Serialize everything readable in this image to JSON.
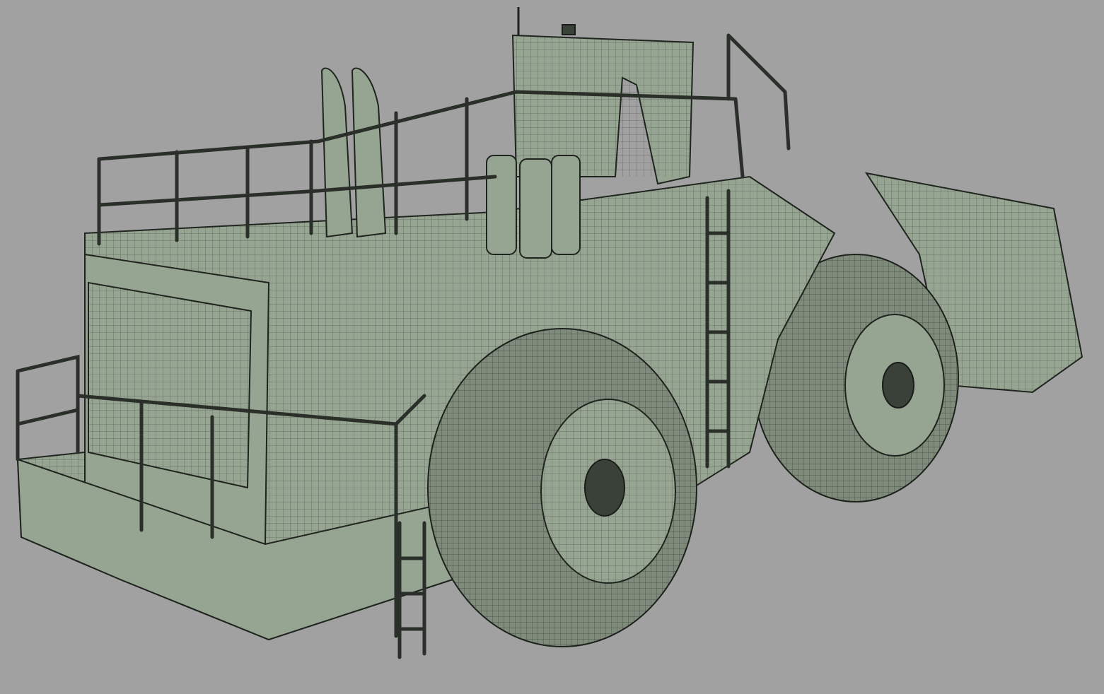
{
  "colors": {
    "background": "#a1a1a1",
    "model_surface": "#96a592",
    "wire_lines": "#1f241e"
  }
}
